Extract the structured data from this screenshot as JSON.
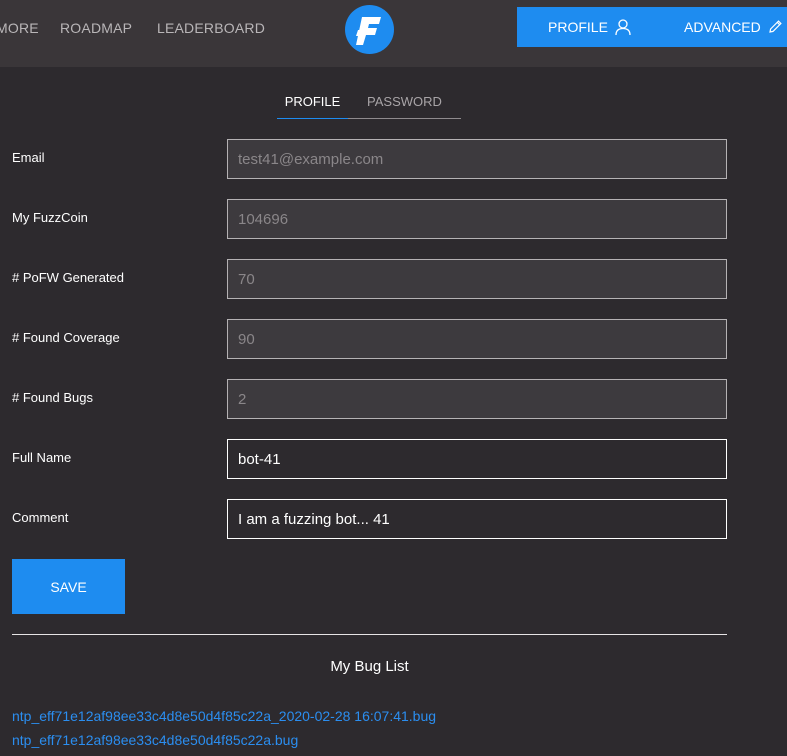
{
  "nav": {
    "more_label": "MORE",
    "roadmap_label": "ROADMAP",
    "leaderboard_label": "LEADERBOARD",
    "logo_letter": "F",
    "profile_label": "PROFILE",
    "advanced_label": "ADVANCED",
    "accent_color": "#1e8cf0"
  },
  "tabs": {
    "profile": "PROFILE",
    "password": "PASSWORD",
    "active": "PROFILE"
  },
  "form": {
    "email": {
      "label": "Email",
      "value": "test41@example.com"
    },
    "fuzzcoin": {
      "label": "My FuzzCoin",
      "value": "104696"
    },
    "pofw": {
      "label": "# PoFW Generated",
      "value": "70"
    },
    "coverage": {
      "label": "# Found Coverage",
      "value": "90"
    },
    "bugs": {
      "label": "# Found Bugs",
      "value": "2"
    },
    "fullname": {
      "label": "Full Name",
      "value": "bot-41"
    },
    "comment": {
      "label": "Comment",
      "value": "I am a fuzzing bot... 41"
    },
    "save_label": "SAVE"
  },
  "bug_list": {
    "title": "My Bug List",
    "items": [
      "ntp_eff71e12af98ee33c4d8e50d4f85c22a_2020-02-28 16:07:41.bug",
      "ntp_eff71e12af98ee33c4d8e50d4f85c22a.bug"
    ]
  },
  "icons": {
    "profile": "user-icon",
    "advanced": "pencil-icon"
  }
}
